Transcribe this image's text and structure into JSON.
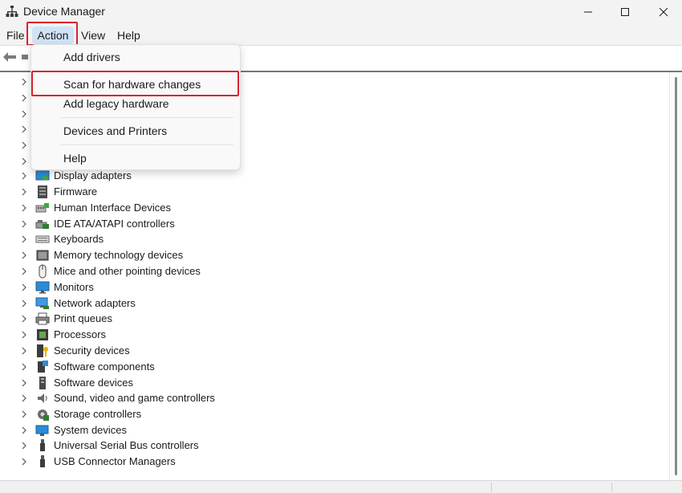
{
  "window": {
    "title": "Device Manager",
    "icons": {
      "app": "device-manager-icon",
      "minimize": "minimize-icon",
      "maximize": "maximize-icon",
      "close": "close-icon"
    }
  },
  "menubar": {
    "file": "File",
    "action": "Action",
    "view": "View",
    "help": "Help"
  },
  "toolbar": {
    "icons": [
      "back-arrow-icon",
      "forward-icon"
    ]
  },
  "action_menu": {
    "items": [
      {
        "label": "Add drivers"
      },
      {
        "label": "Scan for hardware changes",
        "highlighted": true
      },
      {
        "label": "Add legacy hardware"
      },
      {
        "label": "Devices and Printers"
      },
      {
        "label": "Help"
      }
    ]
  },
  "device_tree": {
    "categories": [
      {
        "label": "Display adapters",
        "icon": "display-adapter-icon"
      },
      {
        "label": "Firmware",
        "icon": "firmware-icon"
      },
      {
        "label": "Human Interface Devices",
        "icon": "hid-icon"
      },
      {
        "label": "IDE ATA/ATAPI controllers",
        "icon": "ide-controller-icon"
      },
      {
        "label": "Keyboards",
        "icon": "keyboard-icon"
      },
      {
        "label": "Memory technology devices",
        "icon": "memory-device-icon"
      },
      {
        "label": "Mice and other pointing devices",
        "icon": "mouse-icon"
      },
      {
        "label": "Monitors",
        "icon": "monitor-icon"
      },
      {
        "label": "Network adapters",
        "icon": "network-adapter-icon"
      },
      {
        "label": "Print queues",
        "icon": "printer-icon"
      },
      {
        "label": "Processors",
        "icon": "processor-icon"
      },
      {
        "label": "Security devices",
        "icon": "security-device-icon"
      },
      {
        "label": "Software components",
        "icon": "software-component-icon"
      },
      {
        "label": "Software devices",
        "icon": "software-device-icon"
      },
      {
        "label": "Sound, video and game controllers",
        "icon": "speaker-icon"
      },
      {
        "label": "Storage controllers",
        "icon": "storage-controller-icon"
      },
      {
        "label": "System devices",
        "icon": "system-device-icon"
      },
      {
        "label": "Universal Serial Bus controllers",
        "icon": "usb-icon"
      },
      {
        "label": "USB Connector Managers",
        "icon": "usb-connector-icon"
      }
    ]
  },
  "colors": {
    "highlight_box": "#d9232e",
    "menu_active": "#cfe3f5",
    "chrome_bg": "#f3f3f3"
  }
}
